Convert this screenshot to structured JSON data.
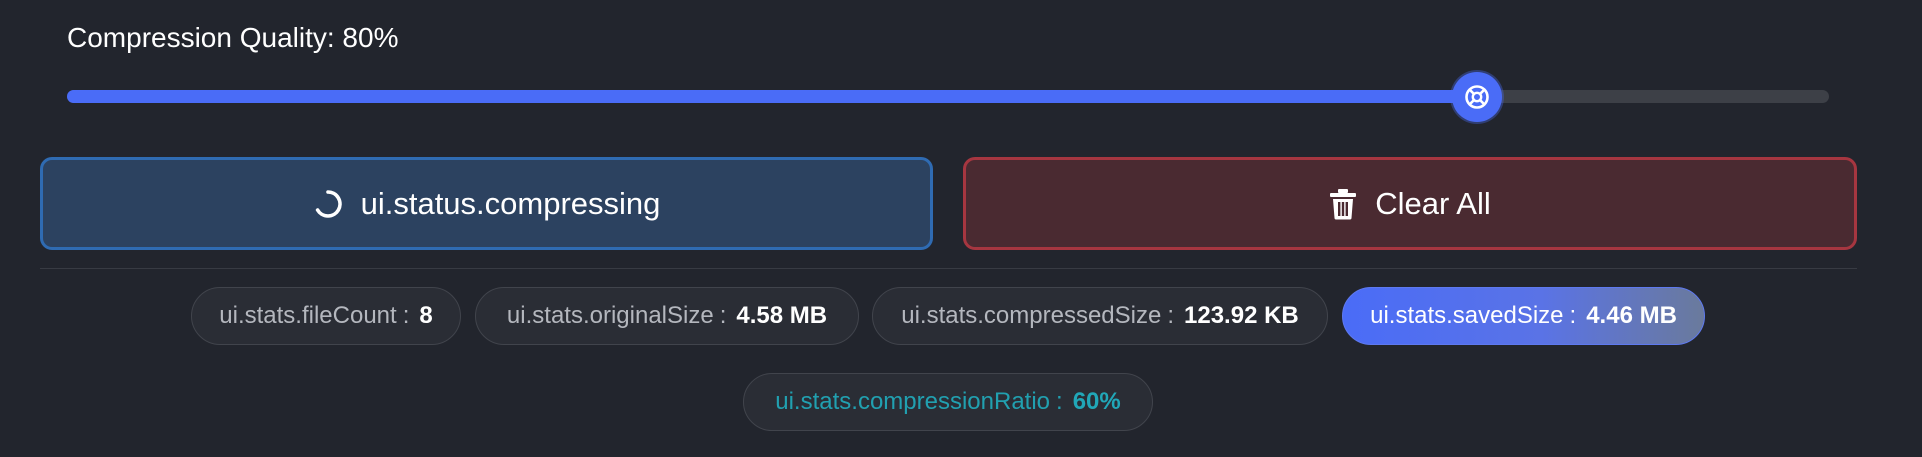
{
  "compression": {
    "label": "Compression Quality: 80%",
    "quality_fraction": 0.8
  },
  "actions": {
    "compress_label": "ui.status.compressing",
    "clear_label": "Clear All"
  },
  "icons": {
    "slider_thumb": "lifebuoy-icon",
    "compress": "spinner-icon",
    "clear": "trash-icon"
  },
  "stats": {
    "file_count": {
      "label": "ui.stats.fileCount",
      "sep": ":",
      "value": "8"
    },
    "original_size": {
      "label": "ui.stats.originalSize",
      "sep": ":",
      "value": "4.58 MB"
    },
    "compressed_size": {
      "label": "ui.stats.compressedSize",
      "sep": ":",
      "value": "123.92 KB"
    },
    "saved_size": {
      "label": "ui.stats.savedSize",
      "sep": ":",
      "value": "4.46 MB"
    },
    "compression_ratio": {
      "label": "ui.stats.compressionRatio",
      "sep": ":",
      "value": "60%"
    }
  },
  "colors": {
    "background": "#22252d",
    "accent": "#4a6cf7",
    "compress_button_bg": "#2c4260",
    "compress_button_border": "#2f6bb2",
    "clear_button_bg": "#4a2a31",
    "clear_button_border": "#a63640",
    "ratio_text": "#21a7b8"
  }
}
